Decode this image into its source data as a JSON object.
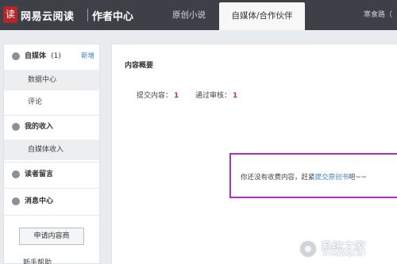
{
  "header": {
    "logo_char": "读",
    "brand": "网易云阅读",
    "subtitle": "作者中心",
    "tabs": [
      {
        "label": "原创小说"
      },
      {
        "label": "自媒体/合作伙伴",
        "active": true
      }
    ],
    "user": "寒食路（"
  },
  "sidebar": {
    "groups": [
      {
        "label": "自媒体",
        "count": "(1)",
        "action": "新增",
        "icon": "user-icon"
      },
      {
        "label": "我的收入",
        "icon": "currency-icon"
      },
      {
        "label": "读者留言",
        "icon": "comment-icon"
      },
      {
        "label": "消息中心",
        "icon": "bell-icon"
      }
    ],
    "subitems": {
      "data_center": "数据中心",
      "comments": "评论",
      "media_income": "自媒体收入"
    },
    "apply_button": "申请内容商",
    "help": "新手帮助"
  },
  "main": {
    "section_title": "内容概要",
    "stats": [
      {
        "label": "提交内容：",
        "value": "1"
      },
      {
        "label": "通过审核：",
        "value": "1"
      }
    ],
    "notice": {
      "text_before": "你还没有收费内容，赶紧",
      "link": "提交原创书",
      "text_after": "吧~~"
    }
  },
  "watermark": {
    "text": "系统之家",
    "sub": "XITONGZHIJIA.NET"
  },
  "colors": {
    "topbar": "#3d4046",
    "accent_link": "#3a86c8",
    "number_red": "#c0392b",
    "highlight_border": "#b12fc2"
  }
}
